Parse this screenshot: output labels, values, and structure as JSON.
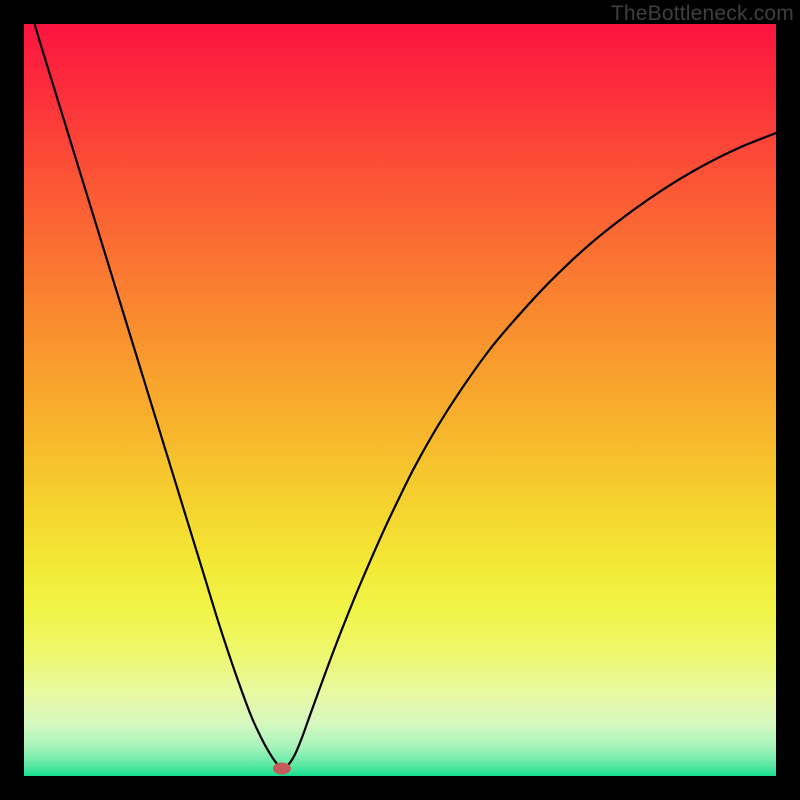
{
  "watermark": "TheBottleneck.com",
  "chart_data": {
    "type": "line",
    "title": "",
    "xlabel": "",
    "ylabel": "",
    "xlim": [
      0,
      100
    ],
    "ylim": [
      0,
      100
    ],
    "grid": false,
    "series": [
      {
        "name": "bottleneck-curve",
        "x": [
          0,
          2,
          4,
          6,
          8,
          10,
          12,
          14,
          16,
          18,
          20,
          22,
          24,
          26,
          28,
          30,
          31,
          32,
          33,
          33.5,
          34,
          34.5,
          35,
          36,
          37,
          38,
          40,
          42,
          44,
          46,
          48,
          50,
          52,
          55,
          58,
          62,
          66,
          70,
          75,
          80,
          85,
          90,
          95,
          100
        ],
        "values": [
          105,
          98,
          91.5,
          85,
          78.5,
          72,
          65.5,
          59,
          52.5,
          46,
          39.5,
          33,
          26.5,
          20,
          14,
          8.5,
          6.2,
          4.2,
          2.5,
          1.8,
          1.2,
          1.0,
          1.3,
          2.8,
          5.2,
          8.0,
          13.5,
          18.8,
          23.8,
          28.5,
          33.0,
          37.2,
          41.2,
          46.5,
          51.2,
          56.8,
          61.5,
          65.8,
          70.5,
          74.5,
          78.0,
          81.0,
          83.5,
          85.5
        ]
      }
    ],
    "marker": {
      "name": "minimum-marker",
      "x": 34.3,
      "y": 1.0,
      "color": "#c45a5a",
      "rx": 9,
      "ry": 6
    },
    "background_gradient": {
      "stops": [
        {
          "offset": 0.0,
          "color": "#fb1440"
        },
        {
          "offset": 0.08,
          "color": "#fc2b3c"
        },
        {
          "offset": 0.18,
          "color": "#fc4c37"
        },
        {
          "offset": 0.3,
          "color": "#fb7032"
        },
        {
          "offset": 0.42,
          "color": "#f9932e"
        },
        {
          "offset": 0.54,
          "color": "#f7b52c"
        },
        {
          "offset": 0.64,
          "color": "#f5d32e"
        },
        {
          "offset": 0.72,
          "color": "#f3e936"
        },
        {
          "offset": 0.78,
          "color": "#f1f448"
        },
        {
          "offset": 0.84,
          "color": "#eef870"
        },
        {
          "offset": 0.89,
          "color": "#e8f9a2"
        },
        {
          "offset": 0.93,
          "color": "#d6f8bf"
        },
        {
          "offset": 0.96,
          "color": "#a8f4bb"
        },
        {
          "offset": 0.985,
          "color": "#5fe9a4"
        },
        {
          "offset": 1.0,
          "color": "#17de8f"
        }
      ]
    }
  }
}
